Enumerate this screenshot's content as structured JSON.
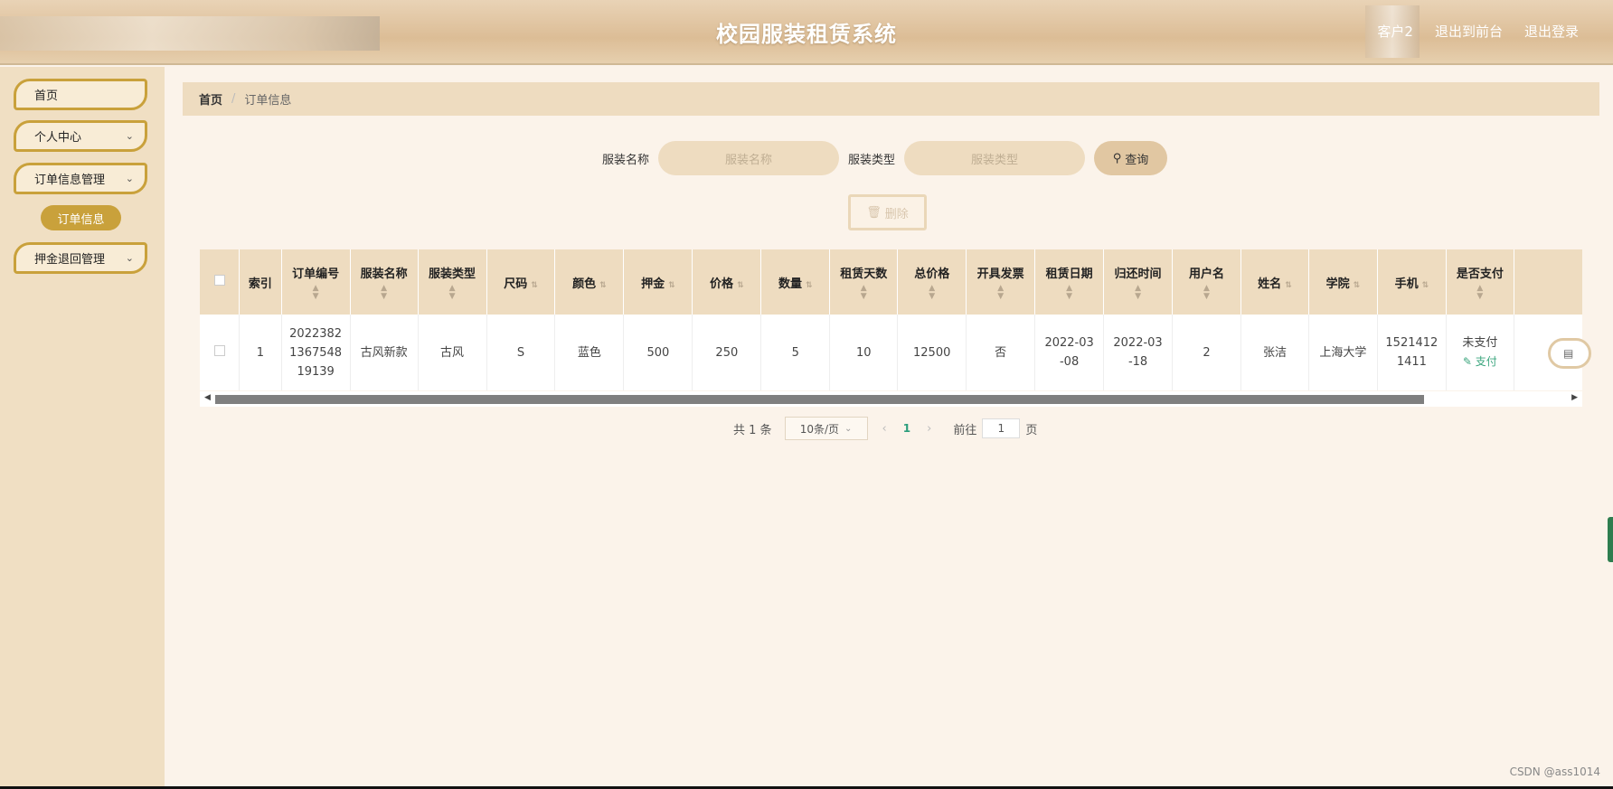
{
  "header": {
    "title": "校园服装租赁系统",
    "user": "客户2",
    "links": [
      "退出到前台",
      "退出登录"
    ]
  },
  "sidebar": {
    "items": [
      {
        "label": "首页",
        "expandable": false
      },
      {
        "label": "个人中心",
        "expandable": true
      },
      {
        "label": "订单信息管理",
        "expandable": true
      },
      {
        "label": "押金退回管理",
        "expandable": true
      }
    ],
    "active_sub": "订单信息"
  },
  "breadcrumb": {
    "home": "首页",
    "current": "订单信息"
  },
  "search": {
    "name_label": "服装名称",
    "name_placeholder": "服装名称",
    "type_label": "服装类型",
    "type_placeholder": "服装类型",
    "query_label": "查询"
  },
  "delete_label": "删除",
  "table": {
    "headers": [
      "索引",
      "订单编号",
      "服装名称",
      "服装类型",
      "尺码",
      "颜色",
      "押金",
      "价格",
      "数量",
      "租赁天数",
      "总价格",
      "开具发票",
      "租赁日期",
      "归还时间",
      "用户名",
      "姓名",
      "学院",
      "手机",
      "是否支付"
    ],
    "row": {
      "index": "1",
      "order_no": [
        "2022382",
        "1367548",
        "19139"
      ],
      "name": "古风新款",
      "type": "古风",
      "size": "S",
      "color": "蓝色",
      "deposit": "500",
      "price": "250",
      "qty": "5",
      "days": "10",
      "total": "12500",
      "invoice": "否",
      "rent_date": [
        "2022-03",
        "-08"
      ],
      "return_date": [
        "2022-03",
        "-18"
      ],
      "username": "2",
      "realname": "张洁",
      "college": "上海大学",
      "phone": [
        "1521412",
        "1411"
      ],
      "pay_status": "未支付",
      "pay_link": "支付"
    }
  },
  "pager": {
    "total": "共 1 条",
    "page_size": "10条/页",
    "current": "1",
    "goto_prefix": "前往",
    "goto_value": "1",
    "goto_suffix": "页"
  },
  "watermark": "CSDN @ass1014",
  "colors": {
    "accent": "#c9a13b",
    "header_bg": "#dcbd96",
    "pay_link": "#3aa57d"
  }
}
